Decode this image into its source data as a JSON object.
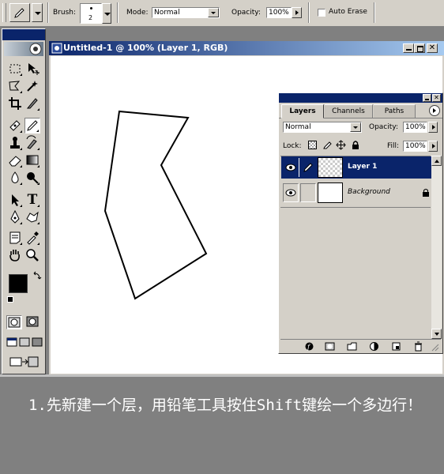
{
  "options_bar": {
    "brush_label": "Brush:",
    "brush_size": "2",
    "mode_label": "Mode:",
    "mode_value": "Normal",
    "opacity_label": "Opacity:",
    "opacity_value": "100%",
    "auto_erase_label": "Auto Erase",
    "auto_erase_checked": false
  },
  "toolbox": {
    "foreground_color": "#000000",
    "background_color": "#ffffff",
    "selected_tool": "pencil-tool"
  },
  "document": {
    "title": "Untitled-1 @ 100% (Layer 1, RGB)",
    "polygon_stroke": "#000000"
  },
  "layers_panel": {
    "tabs": [
      "Layers",
      "Channels",
      "Paths"
    ],
    "active_tab": "Layers",
    "blend_mode": "Normal",
    "opacity_label": "Opacity:",
    "opacity_value": "100%",
    "lock_label": "Lock:",
    "fill_label": "Fill:",
    "fill_value": "100%",
    "layers": [
      {
        "name": "Layer 1",
        "selected": true
      },
      {
        "name": "Background",
        "selected": false,
        "locked": true
      }
    ]
  },
  "caption": {
    "text": "1.先新建一个层，用铅笔工具按住Shift键绘一个多边行！"
  },
  "colors": {
    "ui_gray": "#d4d0c8",
    "title_blue": "#0a246a",
    "workspace_gray": "#808080",
    "selection_blue": "#0a246a"
  }
}
